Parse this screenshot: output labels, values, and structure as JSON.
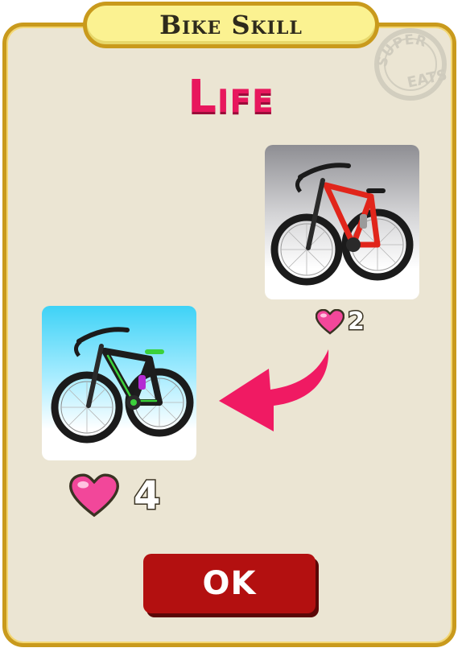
{
  "dialog": {
    "title": "Bike Skill",
    "skill": "Life",
    "ok_label": "OK"
  },
  "stamp": {
    "lines": [
      "SUPER",
      "EATS"
    ]
  },
  "upgrade": {
    "from": {
      "bike": "red-bike",
      "hearts": "2"
    },
    "to": {
      "bike": "green-black-bike",
      "hearts": "4"
    }
  },
  "icons": {
    "heart": "heart-icon",
    "arrow": "curved-arrow-left-icon"
  },
  "colors": {
    "panel": "#ebe5d3",
    "border": "#c99a1c",
    "banner": "#fbf291",
    "skill_text": "#e8175d",
    "heart": "#f2479a",
    "arrow": "#f01a63",
    "ok_button": "#b31010"
  }
}
